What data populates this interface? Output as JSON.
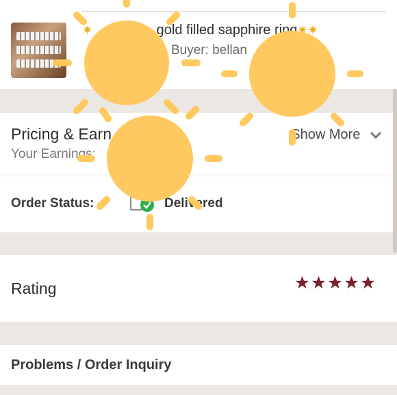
{
  "product": {
    "title": "gold filled sapphire ring",
    "buyer": "Buyer: bellan"
  },
  "pricing": {
    "title": "Pricing & Earn",
    "earnings_label": "Your Earnings:",
    "show_more": "Show More"
  },
  "order_status": {
    "label": "Order Status:",
    "value": "Delivered"
  },
  "rating": {
    "label": "Rating",
    "stars": 5,
    "star_color": "#7a2330"
  },
  "problems": {
    "label": "Problems / Order Inquiry"
  },
  "colors": {
    "background": "#ebe8e3",
    "card": "#ffffff",
    "check_green": "#2eae4c",
    "sticker": "#ffc95f"
  },
  "icons": [
    "sparkle-icon",
    "chevron-down-icon",
    "document-icon",
    "check-icon",
    "star-icon",
    "sun-sticker"
  ]
}
